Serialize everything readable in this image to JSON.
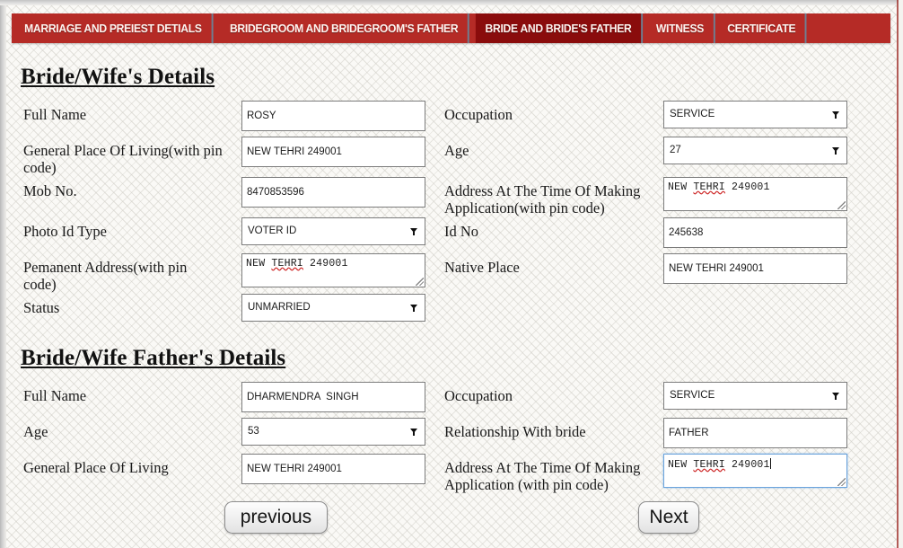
{
  "theme": {
    "tab_bar_red": "#b52b26",
    "tab_active_red": "#8a0c0c",
    "tab_divider": "#6f7f92",
    "page_bg": "#faf9f6",
    "focus_blue": "#6ba4dd",
    "spellcheck_red": "#cc2222"
  },
  "tabs": [
    {
      "label": "MARRIAGE AND PREIEST DETIALS",
      "active": false
    },
    {
      "label": "BRIDEGROOM AND BRIDEGROOM'S FATHER",
      "active": false
    },
    {
      "label": "BRIDE AND BRIDE'S FATHER",
      "active": true
    },
    {
      "label": "WITNESS",
      "active": false
    },
    {
      "label": "CERTIFICATE",
      "active": false
    }
  ],
  "bride_section": {
    "title": "Bride/Wife's Details",
    "fields": {
      "full_name": {
        "label": "Full Name",
        "value": "ROSY",
        "type": "text"
      },
      "general_place_of_living": {
        "label": "General Place Of Living(with pin code)",
        "value": "NEW TEHRI 249001",
        "type": "text"
      },
      "mob_no": {
        "label": "Mob No.",
        "value": "8470853596",
        "type": "text"
      },
      "photo_id_type": {
        "label": "Photo Id Type",
        "value": "VOTER ID",
        "type": "select"
      },
      "permanent_address": {
        "label": "Pemanent Address(with pin code)",
        "value": "NEW TEHRI 249001",
        "type": "textarea",
        "misspelled_word": "TEHRI"
      },
      "status": {
        "label": "Status",
        "value": "UNMARRIED",
        "type": "select"
      },
      "occupation": {
        "label": "Occupation",
        "value": "SERVICE",
        "type": "select"
      },
      "age": {
        "label": "Age",
        "value": "27",
        "type": "select"
      },
      "address_at_application": {
        "label": "Address At The Time Of Making Application(with pin code)",
        "value": "NEW TEHRI 249001",
        "type": "textarea",
        "misspelled_word": "TEHRI"
      },
      "id_no": {
        "label": "Id No",
        "value": "245638",
        "type": "text"
      },
      "native_place": {
        "label": "Native Place",
        "value": "NEW TEHRI 249001",
        "type": "text"
      }
    }
  },
  "father_section": {
    "title": "Bride/Wife Father's Details",
    "fields": {
      "full_name": {
        "label": "Full Name",
        "value": "DHARMENDRA  SINGH",
        "type": "text"
      },
      "age": {
        "label": "Age",
        "value": "53",
        "type": "select"
      },
      "general_place_of_living": {
        "label": "General Place Of Living",
        "value": "NEW TEHRI 249001",
        "type": "text"
      },
      "occupation": {
        "label": "Occupation",
        "value": "SERVICE",
        "type": "select"
      },
      "relationship_with_bride": {
        "label": "Relationship With bride",
        "value": "FATHER",
        "type": "text"
      },
      "address_at_application": {
        "label": "Address At The Time Of Making Application (with pin code)",
        "value": "NEW TEHRI 249001",
        "type": "textarea",
        "misspelled_word": "TEHRI",
        "focused": true
      }
    }
  },
  "buttons": {
    "previous": "previous",
    "next": "Next"
  }
}
